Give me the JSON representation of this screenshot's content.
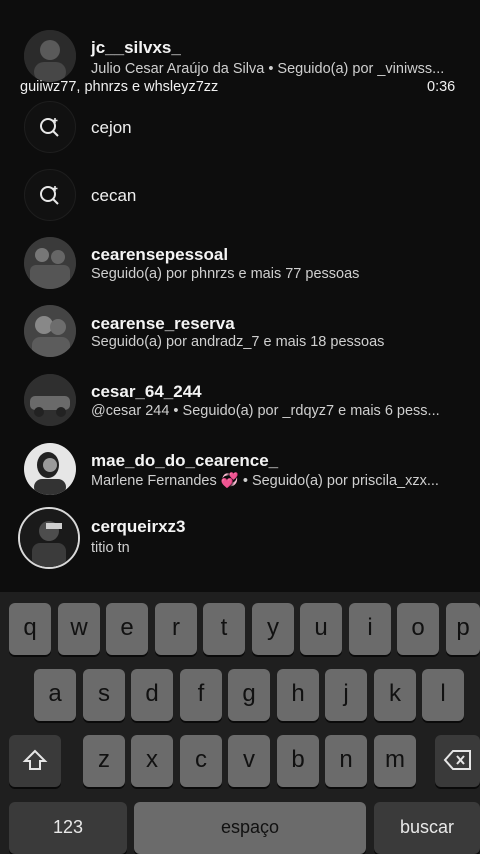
{
  "results": [
    {
      "username": "jc__silvxs_",
      "subtitle": "Julio Cesar Araújo da Silva • Seguido(a) por _viniwss..."
    },
    {
      "query": "cejon"
    },
    {
      "query": "cecan"
    },
    {
      "username": "cearensepessoal",
      "subtitle": "Seguido(a) por phnrzs e mais 77 pessoas"
    },
    {
      "username": "cearense_reserva",
      "subtitle": "Seguido(a) por andradz_7 e mais 18 pessoas"
    },
    {
      "username": "cesar_64_244",
      "subtitle": "@cesar 244 • Seguido(a) por _rdqyz7 e mais 6 pess..."
    },
    {
      "username": "mae_do_do_cearence_",
      "subtitle": "Marlene Fernandes 💞 • Seguido(a) por priscila_xzx..."
    },
    {
      "username": "cerqueirxz3",
      "subtitle": "titio tn"
    }
  ],
  "overlay": {
    "caption": "guiiwz77, phnrzs e whsleyz7zz",
    "time": "0:36"
  },
  "keyboard": {
    "row1": [
      "q",
      "w",
      "e",
      "r",
      "t",
      "y",
      "u",
      "i",
      "o",
      "p"
    ],
    "row2": [
      "a",
      "s",
      "d",
      "f",
      "g",
      "h",
      "j",
      "k",
      "l"
    ],
    "row3": [
      "z",
      "x",
      "c",
      "v",
      "b",
      "n",
      "m"
    ],
    "numbers_label": "123",
    "space_label": "espaço",
    "search_label": "buscar"
  }
}
